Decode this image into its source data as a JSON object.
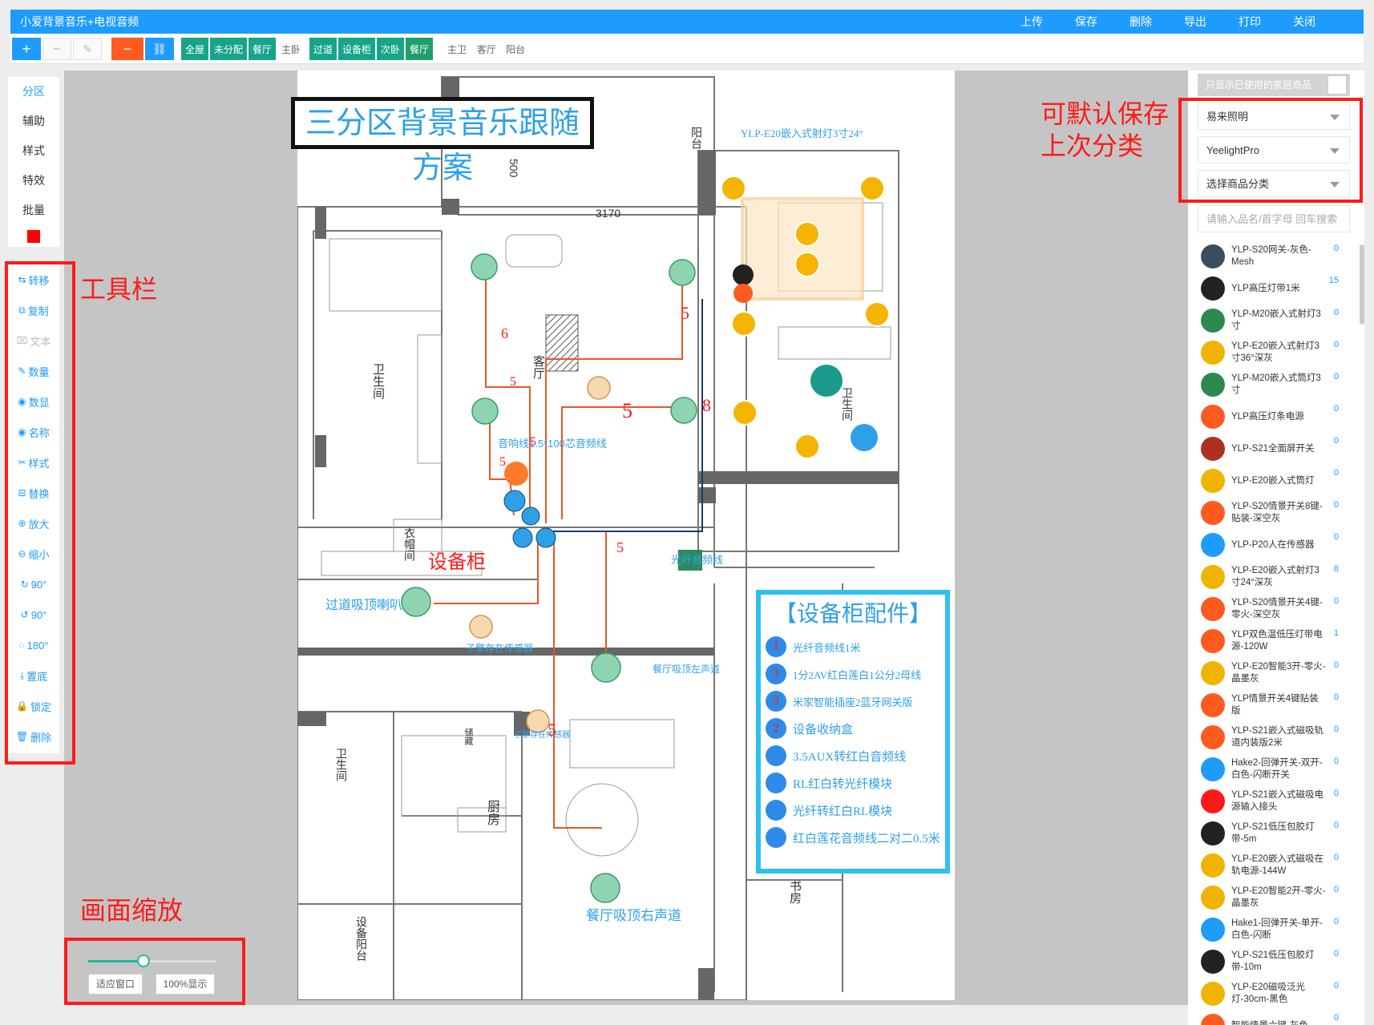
{
  "titlebar": {
    "title": "小爱背景音乐+电视音频",
    "menu": [
      "上传",
      "保存",
      "删除",
      "导出",
      "打印",
      "关闭"
    ]
  },
  "toolbar": {
    "buttons": [
      "+",
      "−",
      "✎",
      "−",
      "🔗"
    ],
    "tags": [
      "全屋",
      "未分配",
      "餐厅",
      "主卧",
      "过道",
      "设备柜",
      "次卧",
      "餐厅",
      "主卫",
      "客厅",
      "阳台"
    ]
  },
  "leftnav": [
    "分区",
    "辅助",
    "样式",
    "特效",
    "批量"
  ],
  "lefttools": [
    "转移",
    "复制",
    "文本",
    "数量",
    "数显",
    "名称",
    "样式",
    "替换",
    "放大",
    "缩小",
    "90°",
    "90°",
    "180°",
    "置底",
    "锁定",
    "删除"
  ],
  "plan": {
    "title": "三分区背景音乐跟随方案",
    "labels": {
      "spot": "YLP-E20嵌入式射灯3寸24°",
      "balcony": "阳台",
      "dim500": "500",
      "dim3170": "3170",
      "bath1": "卫生间",
      "living": "客厅",
      "wire_cable": "音响线1.5*100芯音频线",
      "closet": "衣帽间",
      "cabinet": "设备柜",
      "fiber": "光纤音频线",
      "corridor_speaker": "过道吸顶喇叭",
      "sensor1": "子擎存在传感器",
      "dining_left": "餐厅吸顶左声道",
      "sensor2": "子擎存在传感器",
      "bath2": "卫生间",
      "kitchen": "厨房",
      "dining_right": "餐厅吸顶右声道",
      "equip_balcony": "设备阳台",
      "study": "书房",
      "bath3": "卫生间",
      "storage": "储藏"
    },
    "wire_numbers": [
      "6",
      "5",
      "5",
      "8",
      "5",
      "5",
      "5",
      "5",
      "5"
    ],
    "parts_title": "【设备柜配件】",
    "parts": [
      {
        "n": "1",
        "label": "光纤音频线1米"
      },
      {
        "n": "3",
        "label": "1分2AV红白莲白1公分2母线"
      },
      {
        "n": "3",
        "label": "米家智能插座2蓝牙网关版"
      },
      {
        "n": "2",
        "label": "设备收纳盒"
      },
      {
        "n": "",
        "label": "3.5AUX转红白音频线"
      },
      {
        "n": "",
        "label": "RL红白转光纤模块"
      },
      {
        "n": "",
        "label": "光纤转红白RL模块"
      },
      {
        "n": "",
        "label": "红白莲花音频线二对二0.5米"
      }
    ]
  },
  "sidebar": {
    "filter_label": "只显示已使用的家居商品",
    "brand": "易来照明",
    "series": "YeelightPro",
    "category": "选择商品分类",
    "search_placeholder": "请输入品名/首字母 回车搜索",
    "products": [
      {
        "name": "YLP-S20网关-灰色-Mesh",
        "count": "0",
        "color": "#3a4d5c"
      },
      {
        "name": "YLP高压灯带1米",
        "count": "15",
        "color": "#222"
      },
      {
        "name": "YLP-M20嵌入式射灯3寸",
        "count": "0",
        "color": "#2d8a4e"
      },
      {
        "name": "YLP-E20嵌入式射灯3寸36°深灰",
        "count": "0",
        "color": "#f0b400"
      },
      {
        "name": "YLP-M20嵌入式筒灯3寸",
        "count": "0",
        "color": "#2d8a4e"
      },
      {
        "name": "YLP高压灯条电源",
        "count": "0",
        "color": "#ff5a1f"
      },
      {
        "name": "YLP-S21全面屏开关",
        "count": "0",
        "color": "#b03020"
      },
      {
        "name": "YLP-E20嵌入式筒灯",
        "count": "0",
        "color": "#f0b400"
      },
      {
        "name": "YLP-S20情景开关8键-贴装-深空灰",
        "count": "0",
        "color": "#ff5a1f"
      },
      {
        "name": "YLP-P20人在传感器",
        "count": "0",
        "color": "#1e9bff"
      },
      {
        "name": "YLP-E20嵌入式射灯3寸24°深灰",
        "count": "8",
        "color": "#f0b400"
      },
      {
        "name": "YLP-S20情景开关4键-零火-深空灰",
        "count": "0",
        "color": "#ff5a1f"
      },
      {
        "name": "YLP双色温低压灯带电源-120W",
        "count": "1",
        "color": "#ff5a1f"
      },
      {
        "name": "YLP-E20智能3开-零火-晶墨灰",
        "count": "0",
        "color": "#f0b400"
      },
      {
        "name": "YLP情景开关4键贴装版",
        "count": "0",
        "color": "#ff5a1f"
      },
      {
        "name": "YLP-S21嵌入式磁吸轨道内装版2米",
        "count": "0",
        "color": "#ff5a1f"
      },
      {
        "name": "Hake2-回弹开关-双开-白色-闪断开关",
        "count": "0",
        "color": "#1e9bff"
      },
      {
        "name": "YLP-S21嵌入式磁吸电源输入接头",
        "count": "0",
        "color": "#ff1a1a"
      },
      {
        "name": "YLP-S21低压包胶灯带-5m",
        "count": "0",
        "color": "#222"
      },
      {
        "name": "YLP-E20嵌入式磁吸在轨电源-144W",
        "count": "0",
        "color": "#f0b400"
      },
      {
        "name": "YLP-E20智能2开-零火-晶墨灰",
        "count": "0",
        "color": "#f0b400"
      },
      {
        "name": "Hake1-回弹开关-单开-白色-闪断",
        "count": "0",
        "color": "#1e9bff"
      },
      {
        "name": "YLP-S21低压包胶灯带-10m",
        "count": "0",
        "color": "#222"
      },
      {
        "name": "YLP-E20磁吸泛光灯-30cm-黑色",
        "count": "0",
        "color": "#f0b400"
      },
      {
        "name": "智能情景六键-灰色",
        "count": "0",
        "color": "#ff5a1f"
      }
    ]
  },
  "zoom": {
    "fit": "适应窗口",
    "full": "100%显示",
    "level": 0.43
  },
  "annotations": {
    "toolbar": "工具栏",
    "zoom": "画面缩放",
    "save1": "可默认保存",
    "save2": "上次分类"
  }
}
